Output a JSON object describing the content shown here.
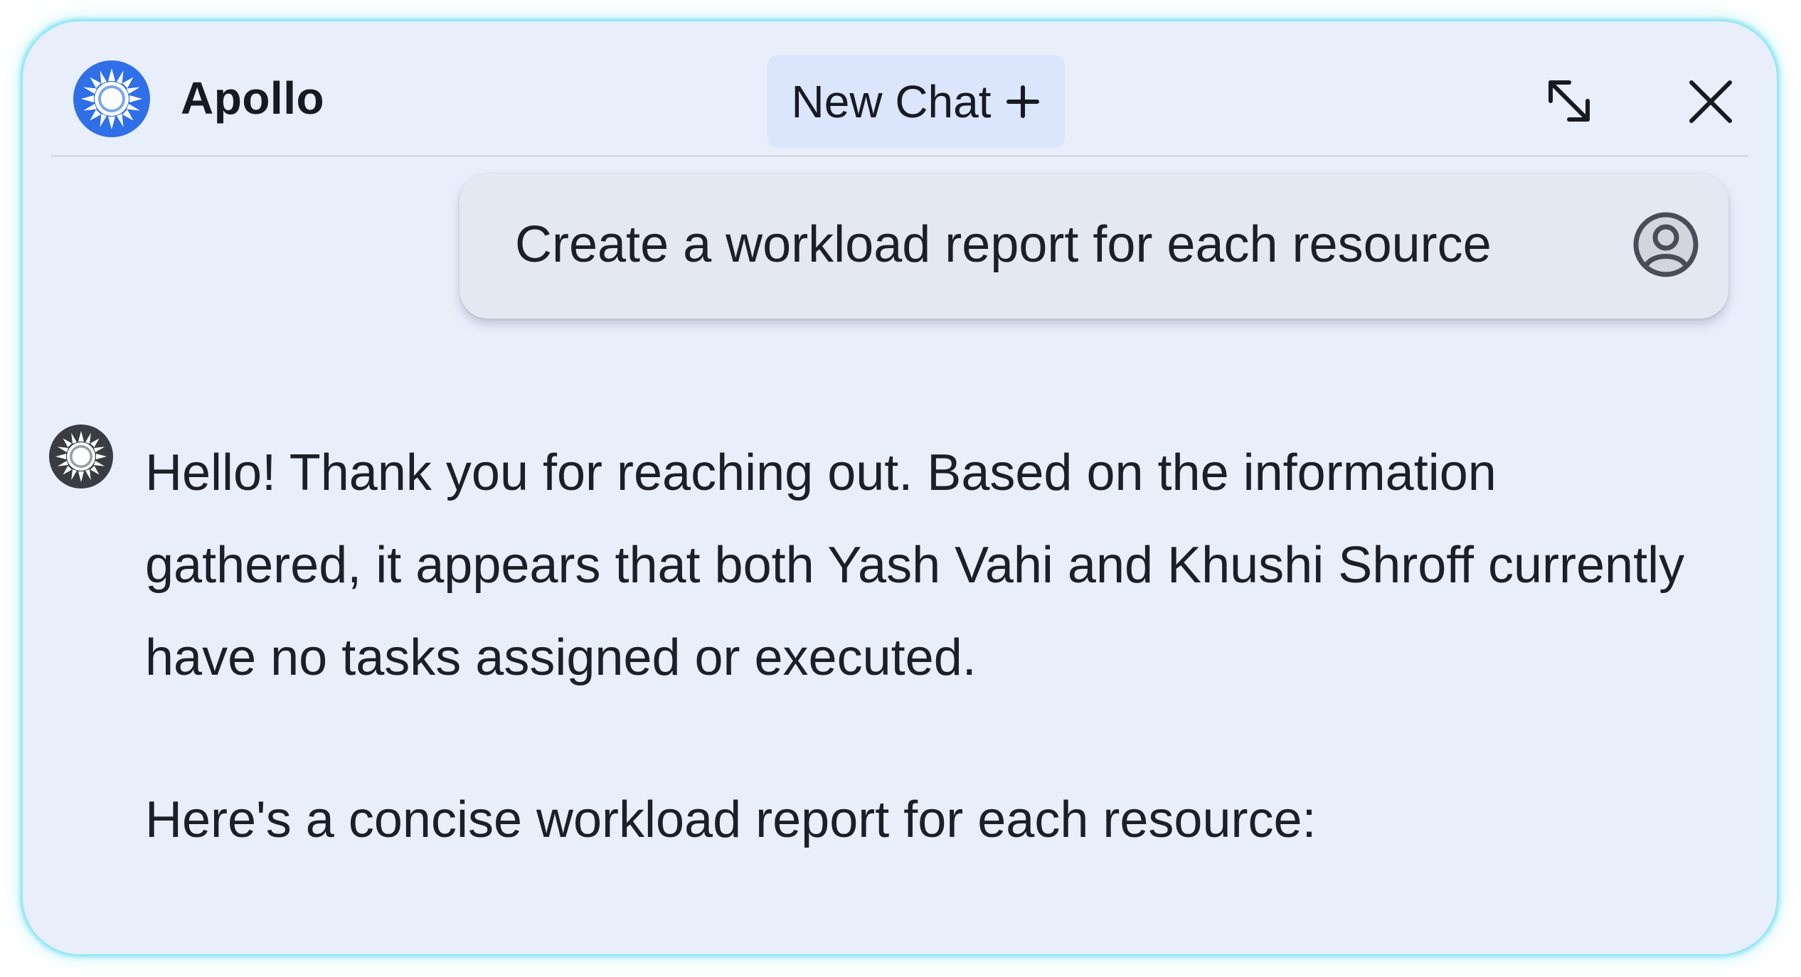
{
  "colors": {
    "panel_background": "#e9eefb",
    "frame_glow": "#78e1f0",
    "new_chat_background": "#dbe5fb",
    "logo_blue": "#2f6fe8",
    "text": "#171a21"
  },
  "header": {
    "logo_icon": "apollo-sun-logo-icon",
    "app_name": "Apollo",
    "new_chat_label": "New Chat",
    "new_chat_icon": "plus-icon",
    "expand_icon": "expand-diagonal-icon",
    "close_icon": "close-icon"
  },
  "conversation": {
    "user_message": {
      "text": "Create a workload report for each resource",
      "avatar_icon": "user-circle-icon"
    },
    "assistant_message": {
      "avatar_icon": "apollo-sun-avatar-icon",
      "paragraphs": [
        "Hello! Thank you for reaching out. Based on the information gathered, it appears that both Yash Vahi and Khushi Shroff currently have no tasks assigned or executed.",
        "Here's a concise workload report for each resource:"
      ]
    }
  }
}
